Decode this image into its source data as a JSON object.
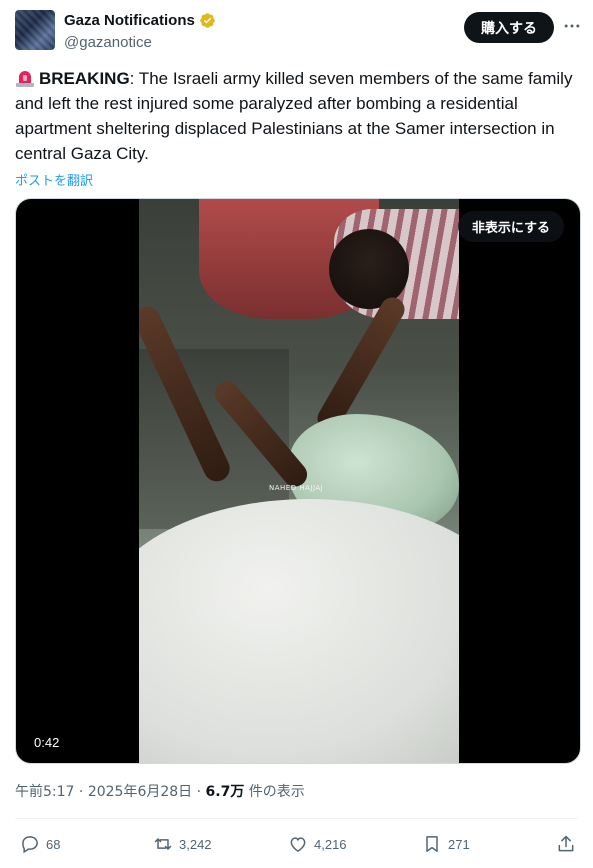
{
  "author": {
    "display_name": "Gaza Notifications",
    "handle": "@gazanotice",
    "verified_badge": "gold-verified-icon"
  },
  "header": {
    "subscribe_label": "購入する",
    "more_icon": "more-horizontal-icon"
  },
  "tweet": {
    "emoji": "rotating-light-siren-icon",
    "lead": "BREAKING",
    "body": ": The Israeli army killed seven members of the same family and left the rest injured some paralyzed after bombing a residential apartment sheltering displaced Palestinians at the Samer intersection in central Gaza City.",
    "translate_label": "ポストを翻訳"
  },
  "media": {
    "hide_label": "非表示にする",
    "duration": "0:42",
    "watermark": "NAHED HAJJAJ"
  },
  "meta": {
    "time": "午前5:17",
    "separator": "·",
    "date": "2025年6月28日",
    "views_count": "6.7万",
    "views_label": "件の表示"
  },
  "actions": {
    "replies": "68",
    "reposts": "3,242",
    "likes": "4,216",
    "bookmarks": "271"
  },
  "colors": {
    "accent": "#1d9bf0",
    "text": "#0f1419",
    "secondary": "#536471",
    "badge_gold": "#e2b719",
    "siren_red": "#e0245e"
  }
}
